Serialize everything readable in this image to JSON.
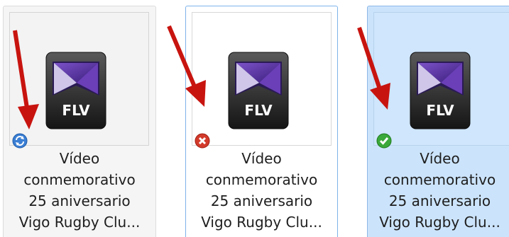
{
  "files": [
    {
      "state": "syncing",
      "type_badge": "FLV",
      "icon": "flv-video-icon",
      "status_icon": "sync-pending-icon",
      "status_color": "#3b7fd4",
      "label_lines": [
        "Vídeo",
        "conmemorativo",
        "25 aniversario",
        "Vigo Rugby Clu..."
      ]
    },
    {
      "state": "error",
      "type_badge": "FLV",
      "icon": "flv-video-icon",
      "status_icon": "sync-error-icon",
      "status_color": "#d23a2a",
      "label_lines": [
        "Vídeo",
        "conmemorativo",
        "25 aniversario",
        "Vigo Rugby Clu..."
      ]
    },
    {
      "state": "synced",
      "type_badge": "FLV",
      "icon": "flv-video-icon",
      "status_icon": "sync-ok-icon",
      "status_color": "#3aa83a",
      "label_lines": [
        "Vídeo",
        "conmemorativo",
        "25 aniversario",
        "Vigo Rugby Clu..."
      ]
    }
  ],
  "annotation": {
    "arrow_color": "#c8140f"
  }
}
